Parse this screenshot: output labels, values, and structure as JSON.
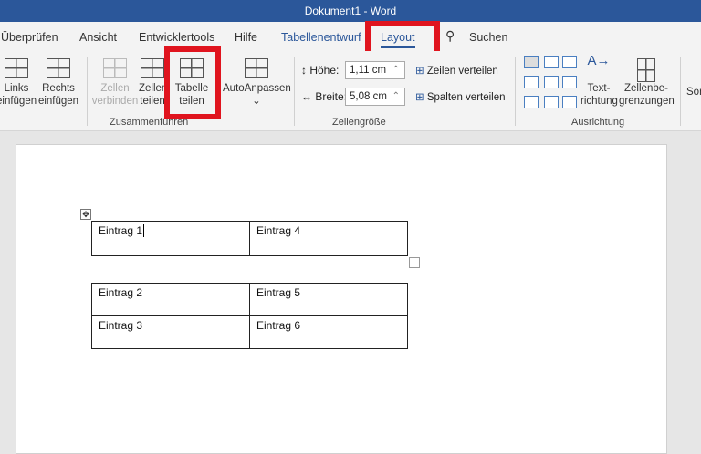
{
  "window": {
    "title": "Dokument1  -  Word"
  },
  "tabs": [
    {
      "label": "Überprüfen"
    },
    {
      "label": "Ansicht"
    },
    {
      "label": "Entwicklertools"
    },
    {
      "label": "Hilfe"
    },
    {
      "label": "Tabellenentwurf"
    },
    {
      "label": "Layout",
      "active": true
    }
  ],
  "search": {
    "label": "Suchen",
    "icon": "search-icon"
  },
  "ribbon": {
    "links": "Links\neinfügen",
    "rechts": "Rechts\neinfügen",
    "zellen_verbinden": "Zellen\nverbinden",
    "zellen_teilen": "Zellen\nteilen",
    "tabelle_teilen": "Tabelle\nteilen",
    "autoanpassen": "AutoAnpassen",
    "hoehe_label": "Höhe:",
    "hoehe_value": "1,11 cm",
    "breite_label": "Breite:",
    "breite_value": "5,08 cm",
    "zeilen_verteilen": "Zeilen verteilen",
    "spalten_verteilen": "Spalten verteilen",
    "textrichtung": "Text-\nrichtung",
    "zellenbegrenzungen": "Zellenbe-\ngrenzungen",
    "sortieren": "Sor",
    "groups": {
      "zusammenfuehren": "Zusammenführen",
      "zellengroesse": "Zellengröße",
      "ausrichtung": "Ausrichtung"
    }
  },
  "highlight_color": "#e0141e",
  "document": {
    "table1": [
      [
        "Eintrag 1",
        "Eintrag 4"
      ]
    ],
    "table2": [
      [
        "Eintrag 2",
        "Eintrag 5"
      ],
      [
        "Eintrag 3",
        "Eintrag 6"
      ]
    ]
  }
}
